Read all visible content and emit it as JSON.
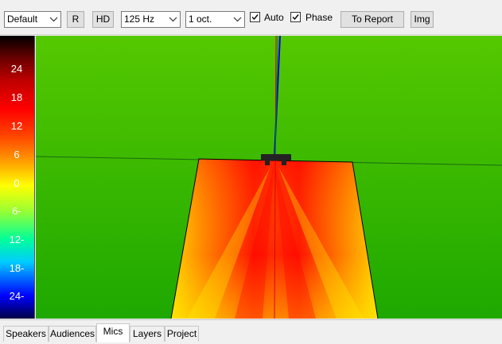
{
  "toolbar": {
    "preset": "Default",
    "r_label": "R",
    "hd_label": "HD",
    "frequency": "125 Hz",
    "bandwidth": "1 oct.",
    "auto_label": "Auto",
    "auto_checked": true,
    "phase_label": "Phase",
    "phase_checked": true,
    "report_label": "To Report",
    "img_label": "Img"
  },
  "scale": {
    "labels": [
      "24",
      "18",
      "12",
      "6",
      "0",
      "6-",
      "12-",
      "18-",
      "24-"
    ]
  },
  "tabs": [
    {
      "label": "Speakers",
      "active": false
    },
    {
      "label": "Audiences",
      "active": false
    },
    {
      "label": "Mics",
      "active": true
    },
    {
      "label": "Layers",
      "active": false
    },
    {
      "label": "Project",
      "active": false
    }
  ],
  "colors": {
    "background_field": "#44bb11",
    "high_level": "#ff2200",
    "low_level": "#ffff00"
  }
}
